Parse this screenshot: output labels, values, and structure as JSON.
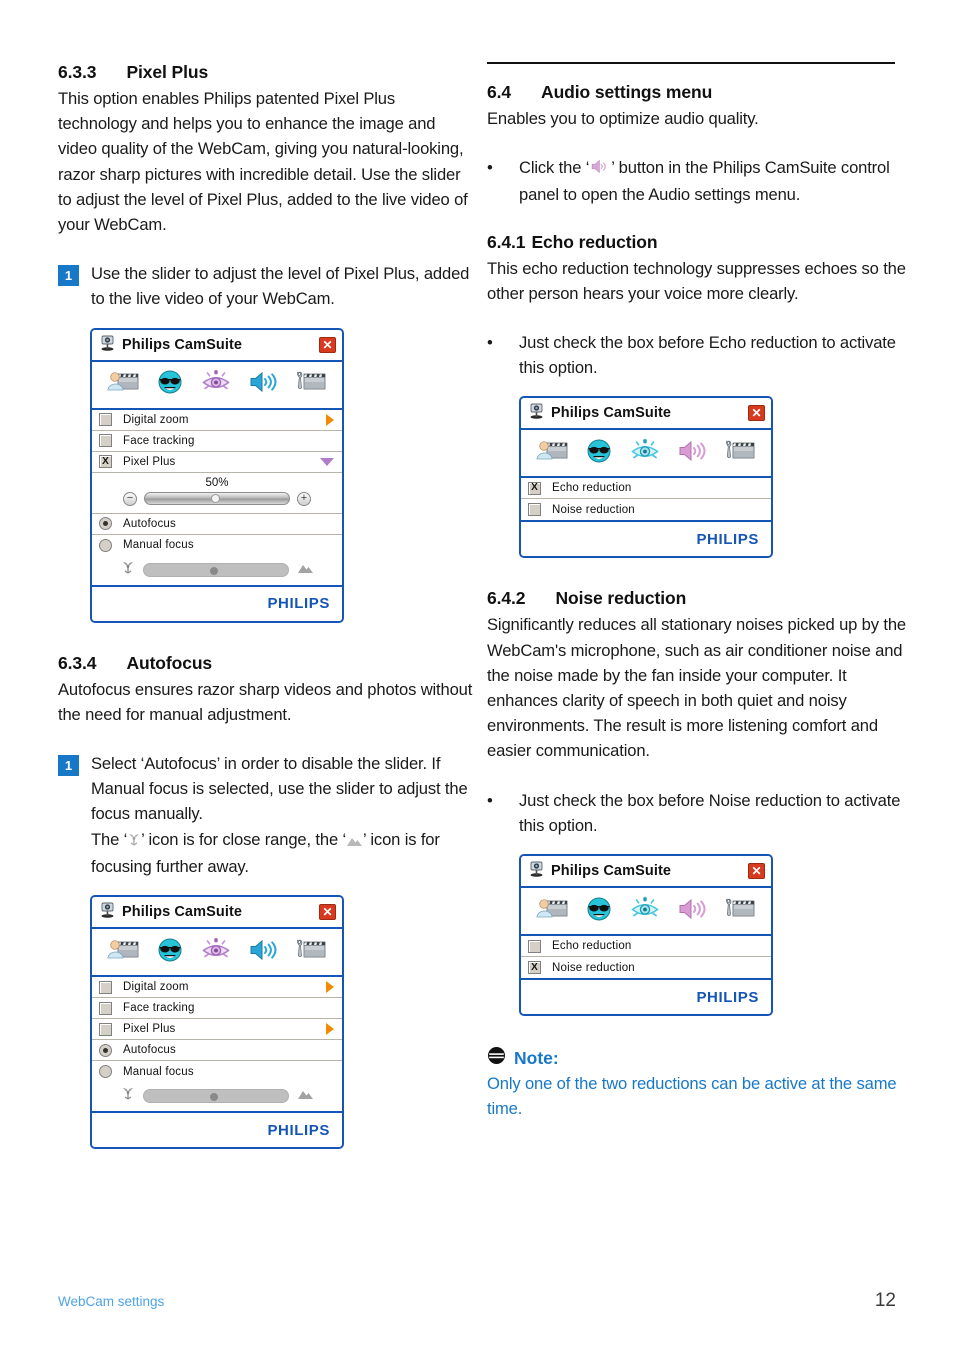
{
  "left_column": {
    "section_633": {
      "number": "6.3.3",
      "title": "Pixel Plus",
      "body": "This option enables Philips patented Pixel Plus technology and helps you to enhance the image and video quality of the WebCam, giving you natural-looking, razor sharp pictures with incredible detail. Use the slider to adjust the level of Pixel Plus, added to the live video of your WebCam.",
      "step_number": "1",
      "step_text": "Use the slider to adjust the level of Pixel Plus, added to the live video of your WebCam."
    },
    "section_634": {
      "number": "6.3.4",
      "title": "Autofocus",
      "body": "Autofocus ensures razor sharp videos and photos without the need for manual adjustment.",
      "step_number": "1",
      "step_text_a": "Select ‘Autofocus’ in order to disable the slider. If Manual focus is selected, use the slider to adjust the focus manually.",
      "step_text_b1": "The ‘",
      "step_text_b2": "’ icon is for close range, the ‘",
      "step_text_b3": "’ icon is for focusing further away."
    }
  },
  "right_column": {
    "section_64": {
      "number": "6.4",
      "title": "Audio settings menu",
      "body": "Enables you to optimize audio quality.",
      "bullet_dot": "•",
      "bullet_a": "Click the ‘",
      "bullet_b": "’ button in the Philips CamSuite control panel to open the Audio settings menu."
    },
    "section_641": {
      "number": "6.4.1",
      "title": "Echo reduction",
      "body": "This echo reduction technology suppresses echoes so the other person hears your voice more clearly.",
      "bullet_dot": "•",
      "bullet_text": "Just check the box before Echo reduction to activate this option."
    },
    "section_642": {
      "number": "6.4.2",
      "title": "Noise reduction",
      "body": "Significantly reduces all stationary noises picked up by the WebCam's microphone, such as air conditioner noise and the noise made by the fan inside your computer. It enhances clarity of speech in both quiet and noisy environments. The result is more listening comfort and easier communication.",
      "bullet_dot": "•",
      "bullet_text": "Just check the box before Noise reduction to activate this option."
    },
    "note": {
      "title": "Note:",
      "body": "Only one of the two reductions can be active at the same time.",
      "color": "#1878c8"
    }
  },
  "camsuite_window_1": {
    "title": "Philips CamSuite",
    "close_label": "✕",
    "toolbar_icons": [
      "video-capture-icon",
      "fun-sunglasses-icon",
      "image-eye-icon",
      "audio-speaker-icon",
      "settings-clapper-icon"
    ],
    "rows": [
      {
        "label": "Digital zoom",
        "checked": false,
        "arrow": "right"
      },
      {
        "label": "Face tracking",
        "checked": false,
        "arrow": "none"
      },
      {
        "label": "Pixel Plus",
        "checked": true,
        "arrow": "down"
      }
    ],
    "check_glyph": "X",
    "slider": {
      "value_label": "50%",
      "percent": 50,
      "minus": "−",
      "plus": "+"
    },
    "focus": {
      "autofocus_label": "Autofocus",
      "manual_label": "Manual focus",
      "selected": "Autofocus",
      "slider_percent": 50
    },
    "brand": "PHILIPS"
  },
  "camsuite_window_2": {
    "title": "Philips CamSuite",
    "close_label": "✕",
    "rows": [
      {
        "label": "Digital zoom",
        "checked": false,
        "arrow": "right"
      },
      {
        "label": "Face tracking",
        "checked": false,
        "arrow": "none"
      },
      {
        "label": "Pixel Plus",
        "checked": false,
        "arrow": "right"
      }
    ],
    "check_glyph": "X",
    "focus": {
      "autofocus_label": "Autofocus",
      "manual_label": "Manual focus",
      "selected": "Autofocus",
      "slider_percent": 50
    },
    "brand": "PHILIPS"
  },
  "camsuite_window_3": {
    "title": "Philips CamSuite",
    "close_label": "✕",
    "rows": [
      {
        "label": "Echo reduction",
        "checked": true
      },
      {
        "label": "Noise reduction",
        "checked": false
      }
    ],
    "check_glyph": "X",
    "brand": "PHILIPS"
  },
  "camsuite_window_4": {
    "title": "Philips CamSuite",
    "close_label": "✕",
    "rows": [
      {
        "label": "Echo reduction",
        "checked": false
      },
      {
        "label": "Noise reduction",
        "checked": true
      }
    ],
    "check_glyph": "X",
    "brand": "PHILIPS"
  },
  "page_footer": {
    "left": "WebCam settings",
    "page_number": "12"
  }
}
